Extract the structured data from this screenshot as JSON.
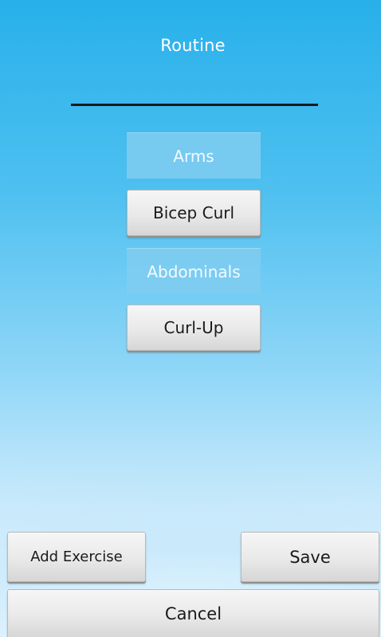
{
  "header": {
    "title": "Routine"
  },
  "routine_name_field": {
    "value": ""
  },
  "routine": {
    "groups": [
      {
        "category": "Arms",
        "exercise": "Bicep Curl"
      },
      {
        "category": "Abdominals",
        "exercise": "Curl-Up"
      }
    ]
  },
  "actions": {
    "add_exercise_label": "Add Exercise",
    "save_label": "Save",
    "cancel_label": "Cancel"
  },
  "colors": {
    "background_top": "#28b0ea",
    "background_bottom": "#e9f6fe",
    "category_fill": "#80ccf0",
    "button_fill": "#e9e9e9"
  }
}
